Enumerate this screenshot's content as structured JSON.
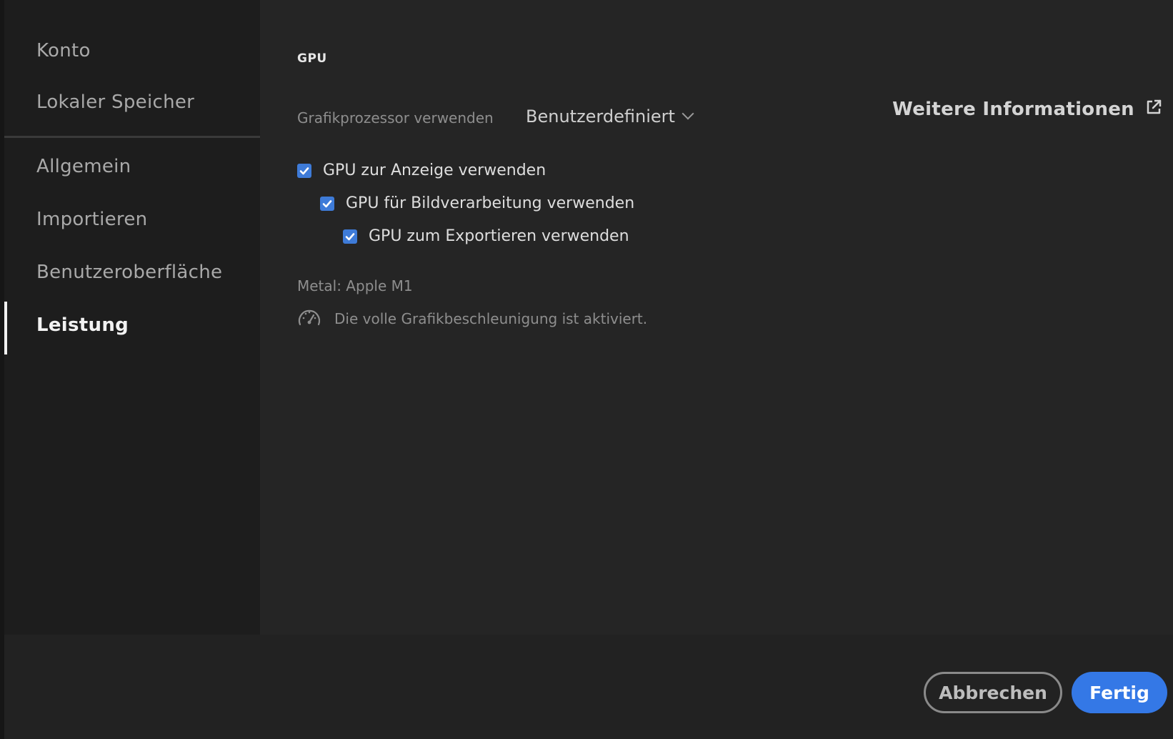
{
  "sidebar": {
    "items": [
      {
        "label": "Konto"
      },
      {
        "label": "Lokaler Speicher"
      },
      {
        "label": "Allgemein"
      },
      {
        "label": "Importieren"
      },
      {
        "label": "Benutzeroberfläche"
      },
      {
        "label": "Leistung",
        "active": true
      }
    ]
  },
  "main": {
    "section_title": "GPU",
    "gpu_label": "Grafikprozessor verwenden",
    "gpu_mode": "Benutzerdefiniert",
    "info_link": "Weitere Informationen",
    "checkboxes": [
      {
        "label": "GPU zur Anzeige verwenden",
        "checked": true
      },
      {
        "label": "GPU für Bildverarbeitung verwenden",
        "checked": true
      },
      {
        "label": "GPU zum Exportieren verwenden",
        "checked": true
      }
    ],
    "metal_info": "Metal: Apple M1",
    "acceleration_status": "Die volle Grafikbeschleunigung ist aktiviert."
  },
  "footer": {
    "cancel_label": "Abbrechen",
    "done_label": "Fertig"
  },
  "colors": {
    "accent": "#3478e6",
    "checkbox": "#3e7bd8"
  },
  "icons": {
    "info_link": "external-link-icon",
    "status": "speedometer-icon",
    "dropdown": "chevron-down-icon",
    "checkbox": "checkmark-icon"
  }
}
